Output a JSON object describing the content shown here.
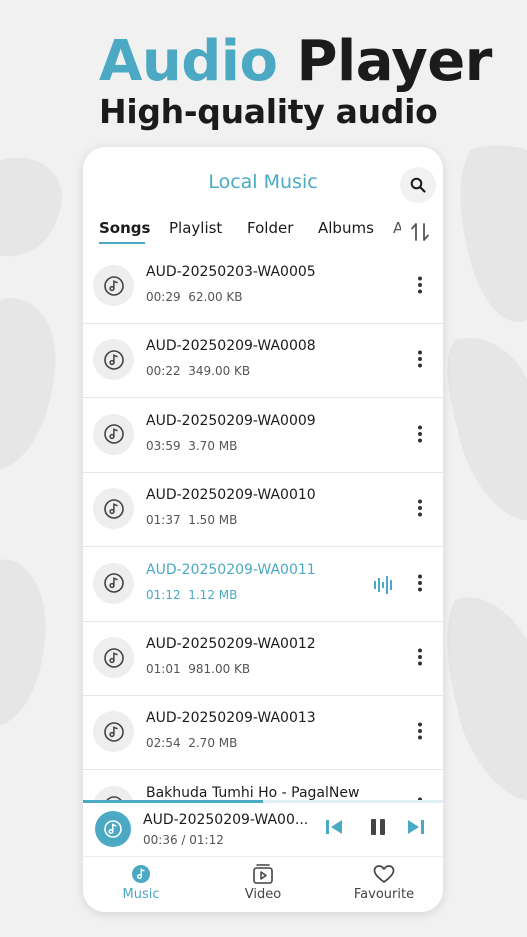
{
  "promo": {
    "headline_word1": "Audio",
    "headline_word2": "Player",
    "subline": "High-quality audio"
  },
  "app": {
    "title": "Local Music",
    "tabs": [
      "Songs",
      "Playlist",
      "Folder",
      "Albums",
      "A"
    ],
    "active_tab": "Songs"
  },
  "songs": [
    {
      "title": "AUD-20250203-WA0005",
      "duration": "00:29",
      "size": "62.00 KB"
    },
    {
      "title": "AUD-20250209-WA0008",
      "duration": "00:22",
      "size": "349.00 KB"
    },
    {
      "title": "AUD-20250209-WA0009",
      "duration": "03:59",
      "size": "3.70 MB"
    },
    {
      "title": "AUD-20250209-WA0010",
      "duration": "01:37",
      "size": "1.50 MB"
    },
    {
      "title": "AUD-20250209-WA0011",
      "duration": "01:12",
      "size": "1.12 MB",
      "playing": true
    },
    {
      "title": "AUD-20250209-WA0012",
      "duration": "01:01",
      "size": "981.00 KB"
    },
    {
      "title": "AUD-20250209-WA0013",
      "duration": "02:54",
      "size": "2.70 MB"
    },
    {
      "title": "Bakhuda Tumhi Ho - PagalNew",
      "duration": "",
      "size": ""
    }
  ],
  "now_playing": {
    "title": "AUD-20250209-WA00...",
    "time": "00:36 / 01:12",
    "progress_fraction": 0.5
  },
  "nav": {
    "music": "Music",
    "video": "Video",
    "favourite": "Favourite"
  },
  "colors": {
    "accent": "#4ba9c4",
    "text": "#1b1b1b",
    "background": "#f1f1f1"
  },
  "icons": [
    "search-icon",
    "sort-icon",
    "music-disc-icon",
    "more-vert-icon",
    "equalizer-icon",
    "previous-icon",
    "pause-icon",
    "next-icon",
    "video-icon",
    "heart-icon"
  ]
}
